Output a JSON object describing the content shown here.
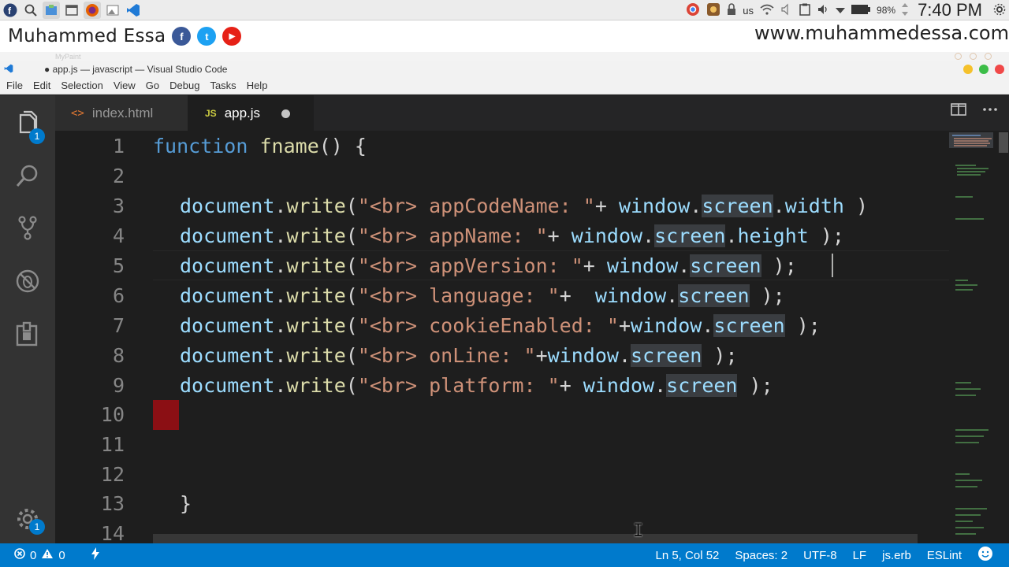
{
  "os_panel": {
    "icons": [
      "fedora-icon",
      "search-icon",
      "files-icon",
      "window-icon",
      "firefox-icon",
      "image-viewer-icon",
      "vscode-icon"
    ],
    "tray": {
      "keyboard_layout": "us",
      "battery": "98%",
      "clock": "7:40 PM"
    }
  },
  "banner": {
    "name": "Muhammed Essa",
    "url": "www.muhammedessa.com",
    "social": [
      {
        "label": "f",
        "color": "#3b5998"
      },
      {
        "label": "t",
        "color": "#1da1f2"
      },
      {
        "label": "▶",
        "color": "#e62117"
      }
    ]
  },
  "behind_window_title": "MyPaint",
  "window": {
    "title": "● app.js — javascript — Visual Studio Code"
  },
  "menu": [
    "File",
    "Edit",
    "Selection",
    "View",
    "Go",
    "Debug",
    "Tasks",
    "Help"
  ],
  "activity": {
    "explorer_badge": "1",
    "settings_badge": "1"
  },
  "tabs": [
    {
      "label": "index.html",
      "icon": "<>"
    },
    {
      "label": "app.js",
      "icon": "JS"
    }
  ],
  "editor": {
    "line_numbers": [
      "1",
      "2",
      "3",
      "4",
      "5",
      "6",
      "7",
      "8",
      "9",
      "10",
      "11",
      "12",
      "13",
      "14"
    ],
    "code": {
      "l1_kw": "function",
      "l1_name": "fname",
      "l1_rest": "() {",
      "obj": "document",
      "method": "write",
      "window_kw": "window",
      "screen": "screen",
      "l3_str": "\"<br> appCodeName: \"",
      "l3_prop": "width",
      "l4_str": "\"<br> appName: \"",
      "l4_prop": "height",
      "l5_str": "\"<br> appVersion: \"",
      "l6_str": "\"<br> language: \"",
      "l7_str": "\"<br> cookieEnabled: \"",
      "l8_str": "\"<br> onLine: \"",
      "l9_str": "\"<br> platform: \"",
      "close_brace": "}"
    }
  },
  "status": {
    "errors": "0",
    "warnings": "0",
    "position": "Ln 5, Col 52",
    "spaces": "Spaces: 2",
    "encoding": "UTF-8",
    "eol": "LF",
    "language": "js.erb",
    "linter": "ESLint"
  },
  "colors": {
    "statusbar": "#007acc",
    "editor_bg": "#1e1e1e",
    "keyword": "#569cd6",
    "string": "#ce9178",
    "function": "#dcdcaa"
  }
}
